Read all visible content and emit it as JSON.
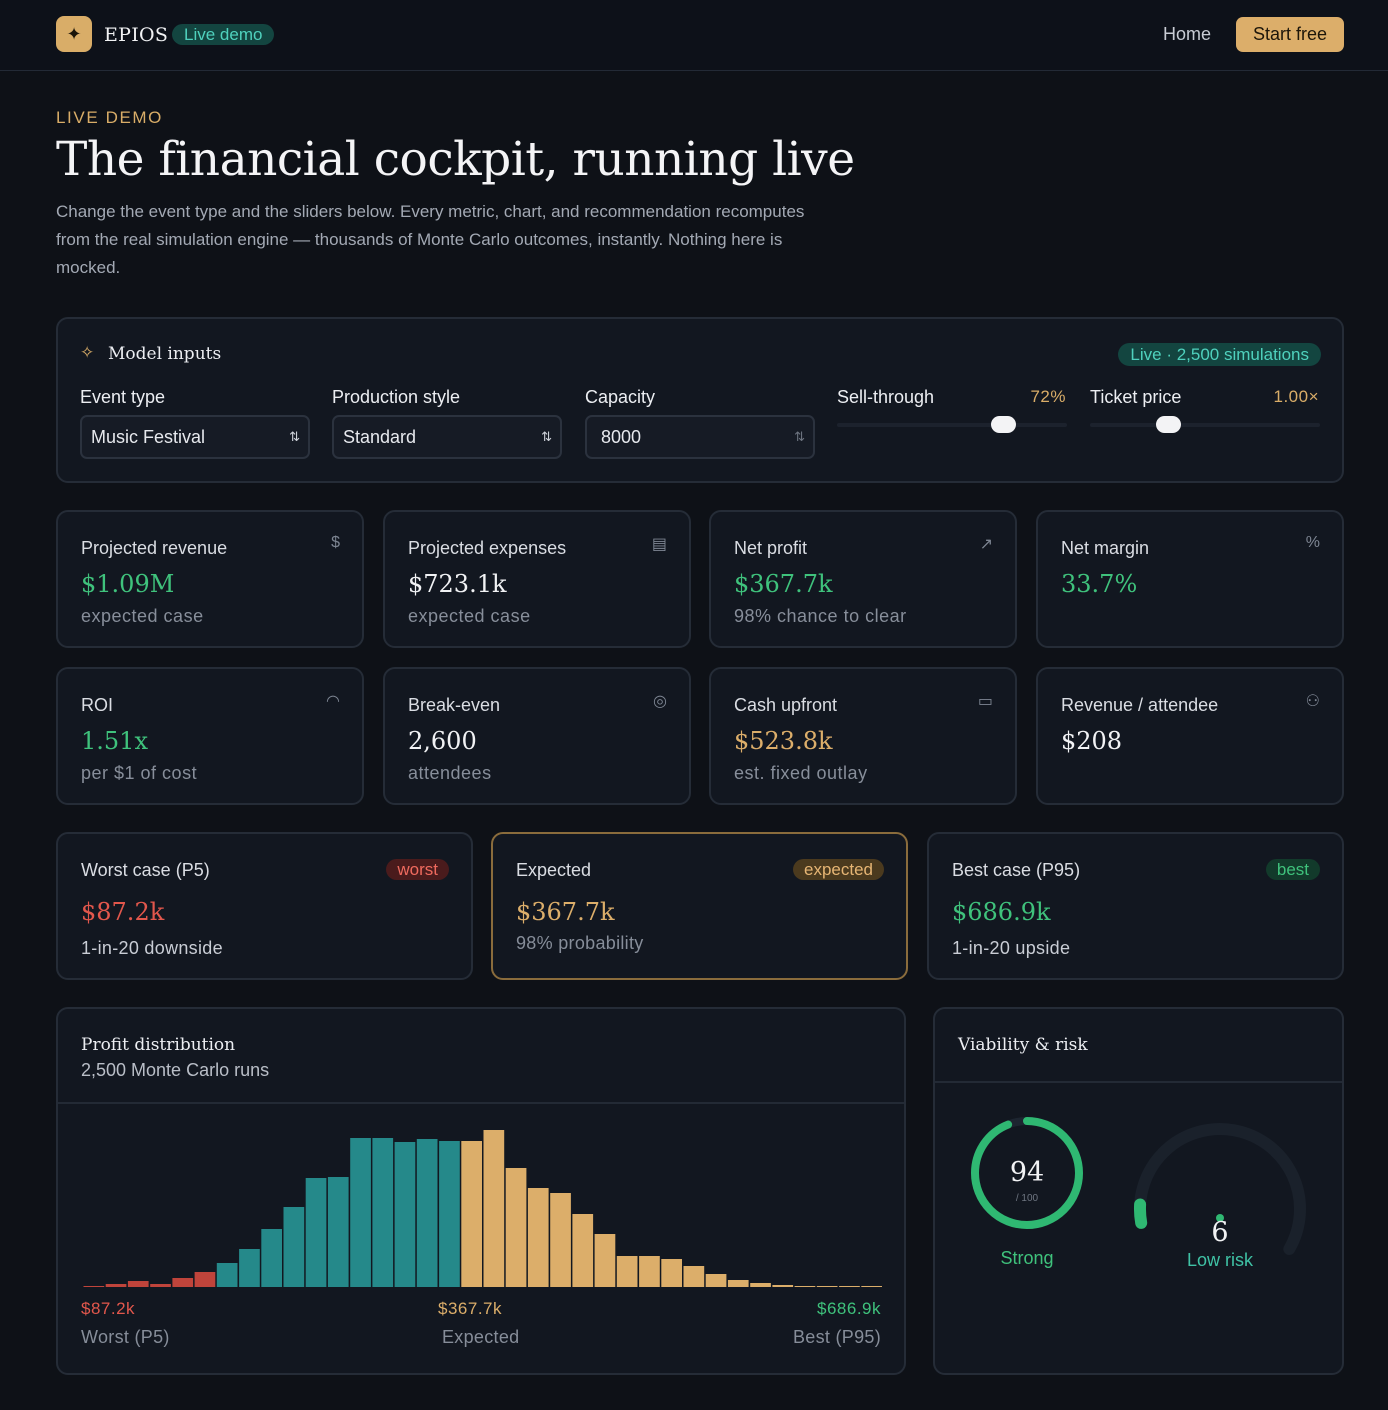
{
  "nav": {
    "logo_glyph": "✦",
    "brand": "EPIOS",
    "demo_badge": "Live demo",
    "home": "Home",
    "cta": "Start free"
  },
  "hero": {
    "eyebrow": "LIVE DEMO",
    "title": "The financial cockpit, running live",
    "subtitle": "Change the event type and the sliders below. Every metric, chart, and recommendation recomputes from the real simulation engine — thousands of Monte Carlo outcomes, instantly. Nothing here is mocked."
  },
  "inputs": {
    "title": "Model inputs",
    "icon": "sparkle-icon",
    "live_badge": "Live · 2,500 simulations",
    "event_type": {
      "label": "Event type",
      "value": "Music Festival"
    },
    "production_style": {
      "label": "Production style",
      "value": "Standard"
    },
    "capacity": {
      "label": "Capacity",
      "value": "8000"
    },
    "sell_through": {
      "label": "Sell-through",
      "display": "72%",
      "fraction": 0.72
    },
    "ticket_price": {
      "label": "Ticket price",
      "display": "1.00×",
      "fraction": 0.34
    }
  },
  "metrics": [
    {
      "label": "Projected revenue",
      "value": "$1.09M",
      "sub": "expected case",
      "icon": "dollar-icon",
      "glyph": "$",
      "tone": "green"
    },
    {
      "label": "Projected expenses",
      "value": "$723.1k",
      "sub": "expected case",
      "icon": "receipt-icon",
      "glyph": "▤",
      "tone": "white"
    },
    {
      "label": "Net profit",
      "value": "$367.7k",
      "sub": "98% chance to clear",
      "icon": "trending-up-icon",
      "glyph": "↗",
      "tone": "green"
    },
    {
      "label": "Net margin",
      "value": "33.7%",
      "sub": "",
      "icon": "percent-icon",
      "glyph": "%",
      "tone": "green"
    },
    {
      "label": "ROI",
      "value": "1.51x",
      "sub": "per $1 of cost",
      "icon": "gauge-icon",
      "glyph": "◠",
      "tone": "green"
    },
    {
      "label": "Break-even",
      "value": "2,600",
      "sub": "attendees",
      "icon": "target-icon",
      "glyph": "◎",
      "tone": "white"
    },
    {
      "label": "Cash upfront",
      "value": "$523.8k",
      "sub": "est. fixed outlay",
      "icon": "wallet-icon",
      "glyph": "▭",
      "tone": "gold"
    },
    {
      "label": "Revenue / attendee",
      "value": "$208",
      "sub": "",
      "icon": "users-icon",
      "glyph": "⚇",
      "tone": "white"
    }
  ],
  "scenarios": [
    {
      "label": "Worst case (P5)",
      "badge": "worst",
      "value": "$87.2k",
      "sub": "1-in-20 downside",
      "tone": "red"
    },
    {
      "label": "Expected",
      "badge": "expected",
      "value": "$367.7k",
      "sub": "98% probability",
      "tone": "gold"
    },
    {
      "label": "Best case (P95)",
      "badge": "best",
      "value": "$686.9k",
      "sub": "1-in-20 upside",
      "tone": "green"
    }
  ],
  "distribution": {
    "title": "Profit distribution",
    "subtitle": "2,500 Monte Carlo runs",
    "colors": {
      "worst": "#c0443b",
      "mid": "#25898a",
      "upper": "#dcae6a"
    },
    "bins": [
      {
        "v": 1,
        "z": "worst"
      },
      {
        "v": 3,
        "z": "worst"
      },
      {
        "v": 6,
        "z": "worst"
      },
      {
        "v": 3,
        "z": "worst"
      },
      {
        "v": 9,
        "z": "worst"
      },
      {
        "v": 15,
        "z": "worst"
      },
      {
        "v": 24,
        "z": "mid"
      },
      {
        "v": 38,
        "z": "mid"
      },
      {
        "v": 58,
        "z": "mid"
      },
      {
        "v": 80,
        "z": "mid"
      },
      {
        "v": 109,
        "z": "mid"
      },
      {
        "v": 110,
        "z": "mid"
      },
      {
        "v": 149,
        "z": "mid"
      },
      {
        "v": 149,
        "z": "mid"
      },
      {
        "v": 145,
        "z": "mid"
      },
      {
        "v": 148,
        "z": "mid"
      },
      {
        "v": 146,
        "z": "mid"
      },
      {
        "v": 146,
        "z": "upper"
      },
      {
        "v": 157,
        "z": "upper"
      },
      {
        "v": 119,
        "z": "upper"
      },
      {
        "v": 99,
        "z": "upper"
      },
      {
        "v": 94,
        "z": "upper"
      },
      {
        "v": 73,
        "z": "upper"
      },
      {
        "v": 53,
        "z": "upper"
      },
      {
        "v": 31,
        "z": "upper"
      },
      {
        "v": 31,
        "z": "upper"
      },
      {
        "v": 28,
        "z": "upper"
      },
      {
        "v": 21,
        "z": "upper"
      },
      {
        "v": 13,
        "z": "upper"
      },
      {
        "v": 7,
        "z": "upper"
      },
      {
        "v": 4,
        "z": "upper"
      },
      {
        "v": 2,
        "z": "upper"
      },
      {
        "v": 1,
        "z": "upper"
      },
      {
        "v": 1,
        "z": "upper"
      },
      {
        "v": 1,
        "z": "upper"
      },
      {
        "v": 1,
        "z": "upper"
      }
    ],
    "max": 160,
    "axis": [
      {
        "value": "$87.2k",
        "label": "Worst (P5)",
        "tone": "red"
      },
      {
        "value": "$367.7k",
        "label": "Expected",
        "tone": "gold"
      },
      {
        "value": "$686.9k",
        "label": "Best (P95)",
        "tone": "green"
      }
    ]
  },
  "viability": {
    "title": "Viability & risk",
    "score": {
      "value": "94",
      "denominator": "/ 100",
      "label": "Strong",
      "fraction": 0.94,
      "color": "#2fb872"
    },
    "risk": {
      "value": "6",
      "label": "Low risk",
      "fraction": 0.06,
      "color": "#2fb872",
      "label_color": "#3fc2a5"
    }
  }
}
